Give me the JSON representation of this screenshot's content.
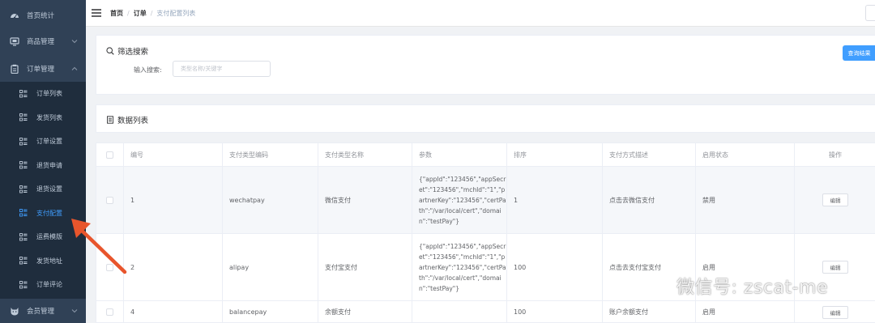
{
  "sidebar": {
    "menu": [
      {
        "label": "首页统计",
        "icon": "dashboard-icon"
      },
      {
        "label": "商品管理",
        "icon": "monitor-icon"
      },
      {
        "label": "订单管理",
        "icon": "clipboard-icon"
      }
    ],
    "order_submenu": [
      {
        "label": "订单列表"
      },
      {
        "label": "发货列表"
      },
      {
        "label": "订单设置"
      },
      {
        "label": "退货申请"
      },
      {
        "label": "退货设置"
      },
      {
        "label": "支付配置"
      },
      {
        "label": "运费模版"
      },
      {
        "label": "发货地址"
      },
      {
        "label": "订单评论"
      }
    ],
    "bottom_menu": {
      "label": "会员管理",
      "icon": "cat-icon"
    },
    "active_sub_index": 5
  },
  "breadcrumb": {
    "home": "首页",
    "sep": "/",
    "order": "订单",
    "current": "支付配置列表"
  },
  "search": {
    "title": "筛选搜索",
    "label": "输入搜索:",
    "placeholder": "类型名称/关键字",
    "query_button": "查询结果"
  },
  "list": {
    "title": "数据列表"
  },
  "table": {
    "columns": [
      "编号",
      "支付类型编码",
      "支付类型名称",
      "参数",
      "排序",
      "支付方式描述",
      "启用状态",
      "操作"
    ],
    "rows": [
      {
        "id": "1",
        "code": "wechatpay",
        "name": "微信支付",
        "params": "{\"appId\":\"123456\",\"appSecret\":\"123456\",\"mchId\":\"1\",\"partnerKey\":\"123456\",\"certPath\":\"/var/local/cert\",\"domain\":\"testPay\"}",
        "sort": "1",
        "desc": "点击去微信支付",
        "status": "禁用",
        "action": "编辑"
      },
      {
        "id": "2",
        "code": "alipay",
        "name": "支付宝支付",
        "params": "{\"appId\":\"123456\",\"appSecret\":\"123456\",\"mchId\":\"1\",\"partnerKey\":\"123456\",\"certPath\":\"/var/local/cert\",\"domain\":\"testPay\"}",
        "sort": "100",
        "desc": "点击去支付宝支付",
        "status": "启用",
        "action": "编辑"
      },
      {
        "id": "4",
        "code": "balancepay",
        "name": "余额支付",
        "params": "",
        "sort": "100",
        "desc": "账户余额支付",
        "status": "启用",
        "action": "编辑"
      }
    ]
  },
  "watermark": {
    "text": "微信号: zscat-me"
  },
  "colors": {
    "sidebar_bg": "#304156",
    "submenu_bg": "#1f2d3d",
    "accent": "#409eff",
    "arrow": "#e8552c"
  }
}
